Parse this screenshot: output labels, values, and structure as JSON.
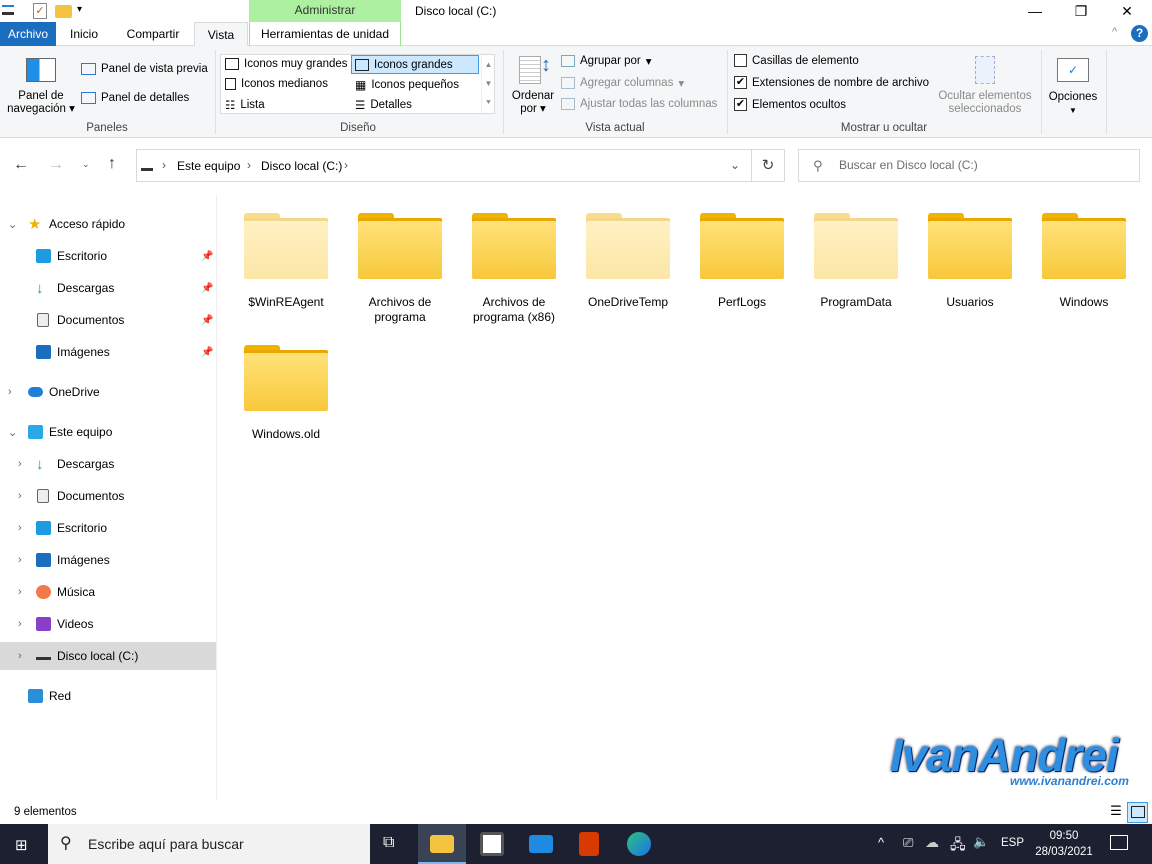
{
  "window": {
    "title": "Disco local (C:)",
    "context_header": "Administrar"
  },
  "tabs": [
    "Archivo",
    "Inicio",
    "Compartir",
    "Vista",
    "Herramientas de unidad"
  ],
  "ribbon": {
    "panes": {
      "nav_pane_1": "Panel de",
      "nav_pane_2": "navegación",
      "preview": "Panel de vista previa",
      "details": "Panel de detalles",
      "group": "Paneles"
    },
    "layout": {
      "items": [
        "Iconos muy grandes",
        "Iconos grandes",
        "Iconos medianos",
        "Iconos pequeños",
        "Lista",
        "Detalles"
      ],
      "selected": "Iconos grandes",
      "group": "Diseño"
    },
    "current_view": {
      "sort_1": "Ordenar",
      "sort_2": "por",
      "group_by": "Agrupar por",
      "add_columns": "Agregar columnas",
      "fit_columns": "Ajustar todas las columnas",
      "group": "Vista actual"
    },
    "show_hide": {
      "checkboxes": [
        {
          "label": "Casillas de elemento",
          "checked": false
        },
        {
          "label": "Extensiones de nombre de archivo",
          "checked": true
        },
        {
          "label": "Elementos ocultos",
          "checked": true
        }
      ],
      "hide_selected_1": "Ocultar elementos",
      "hide_selected_2": "seleccionados",
      "group": "Mostrar u ocultar"
    },
    "options": "Opciones"
  },
  "address": {
    "crumbs": [
      "Este equipo",
      "Disco local (C:)"
    ],
    "search_placeholder": "Buscar en Disco local (C:)"
  },
  "nav": {
    "quick_access": "Acceso rápido",
    "quick_items": [
      "Escritorio",
      "Descargas",
      "Documentos",
      "Imágenes"
    ],
    "onedrive": "OneDrive",
    "this_pc": "Este equipo",
    "pc_items": [
      "Descargas",
      "Documentos",
      "Escritorio",
      "Imágenes",
      "Música",
      "Videos",
      "Disco local (C:)"
    ],
    "network": "Red"
  },
  "folders": [
    {
      "name": "$WinREAgent",
      "hidden": true
    },
    {
      "name": "Archivos de programa",
      "hidden": false
    },
    {
      "name": "Archivos de programa (x86)",
      "hidden": false
    },
    {
      "name": "OneDriveTemp",
      "hidden": true
    },
    {
      "name": "PerfLogs",
      "hidden": false
    },
    {
      "name": "ProgramData",
      "hidden": true
    },
    {
      "name": "Usuarios",
      "hidden": false
    },
    {
      "name": "Windows",
      "hidden": false
    },
    {
      "name": "Windows.old",
      "hidden": false
    }
  ],
  "status": {
    "count": "9 elementos"
  },
  "taskbar": {
    "search": "Escribe aquí para buscar",
    "lang": "ESP",
    "time": "09:50",
    "date": "28/03/2021"
  },
  "watermark": {
    "name": "IvanAndrei",
    "url": "www.ivanandrei.com"
  }
}
